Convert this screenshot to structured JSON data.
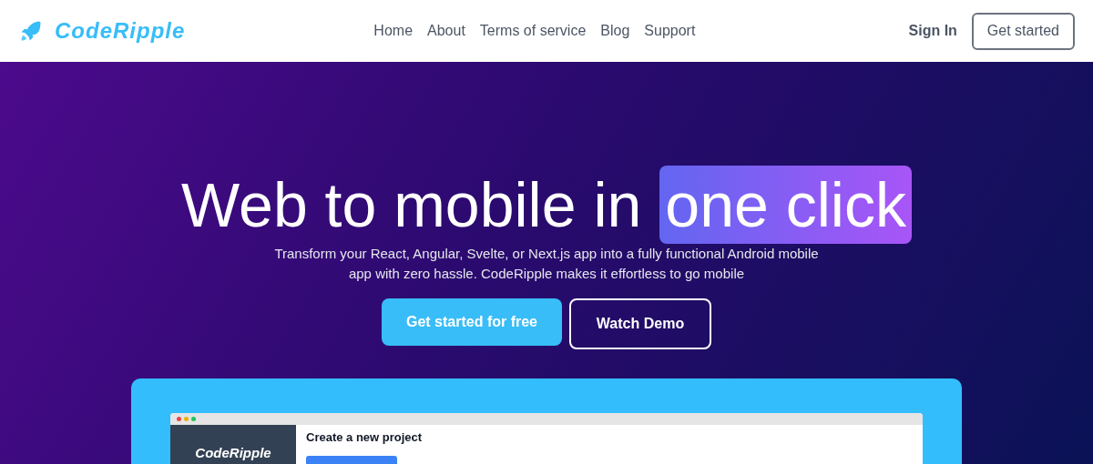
{
  "header": {
    "logo": "CodeRipple",
    "nav": [
      {
        "label": "Home"
      },
      {
        "label": "About"
      },
      {
        "label": "Terms of service"
      },
      {
        "label": "Blog"
      },
      {
        "label": "Support"
      }
    ],
    "sign_in": "Sign In",
    "get_started": "Get started"
  },
  "hero": {
    "title": "Web to mobile in",
    "title_highlight": "one click",
    "subtitle": "Transform your React, Angular, Svelte, or Next.js app into a fully functional Android mobile app with zero hassle. CodeRipple makes it effortless to go mobile",
    "primary_button": "Get started for free",
    "secondary_button": "Watch Demo"
  },
  "preview": {
    "sidebar_logo": "CodeRipple",
    "heading": "Create a new project"
  }
}
